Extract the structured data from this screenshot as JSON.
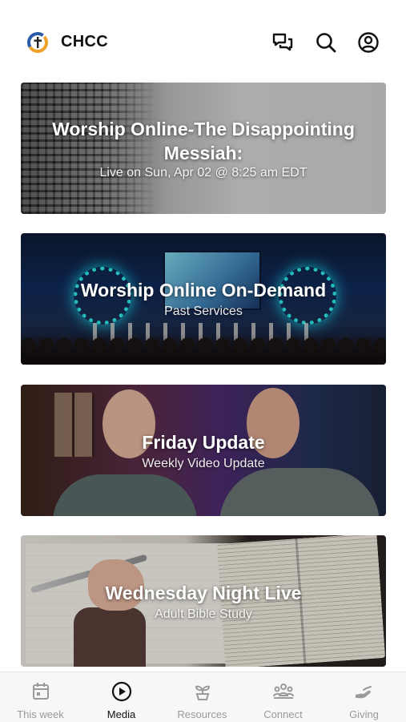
{
  "header": {
    "title": "CHCC",
    "icons": [
      "chat-icon",
      "search-icon",
      "profile-icon"
    ]
  },
  "cards": [
    {
      "title": "Worship Online-The Disappointing Messiah:",
      "subtitle": "Live on Sun, Apr 02 @ 8:25 am EDT"
    },
    {
      "title": "Worship Online On-Demand",
      "subtitle": "Past Services"
    },
    {
      "title": "Friday Update",
      "subtitle": "Weekly Video Update"
    },
    {
      "title": "Wednesday Night Live",
      "subtitle": "Adult Bible Study"
    }
  ],
  "tabs": [
    {
      "label": "This week",
      "icon": "calendar-icon",
      "active": false
    },
    {
      "label": "Media",
      "icon": "play-icon",
      "active": true
    },
    {
      "label": "Resources",
      "icon": "plant-icon",
      "active": false
    },
    {
      "label": "Connect",
      "icon": "group-icon",
      "active": false
    },
    {
      "label": "Giving",
      "icon": "giving-icon",
      "active": false
    }
  ],
  "colors": {
    "accent": "#111111",
    "inactive_tab": "#9a9a9a",
    "logo_orange": "#f0a12a",
    "logo_blue": "#2a5aa8"
  }
}
